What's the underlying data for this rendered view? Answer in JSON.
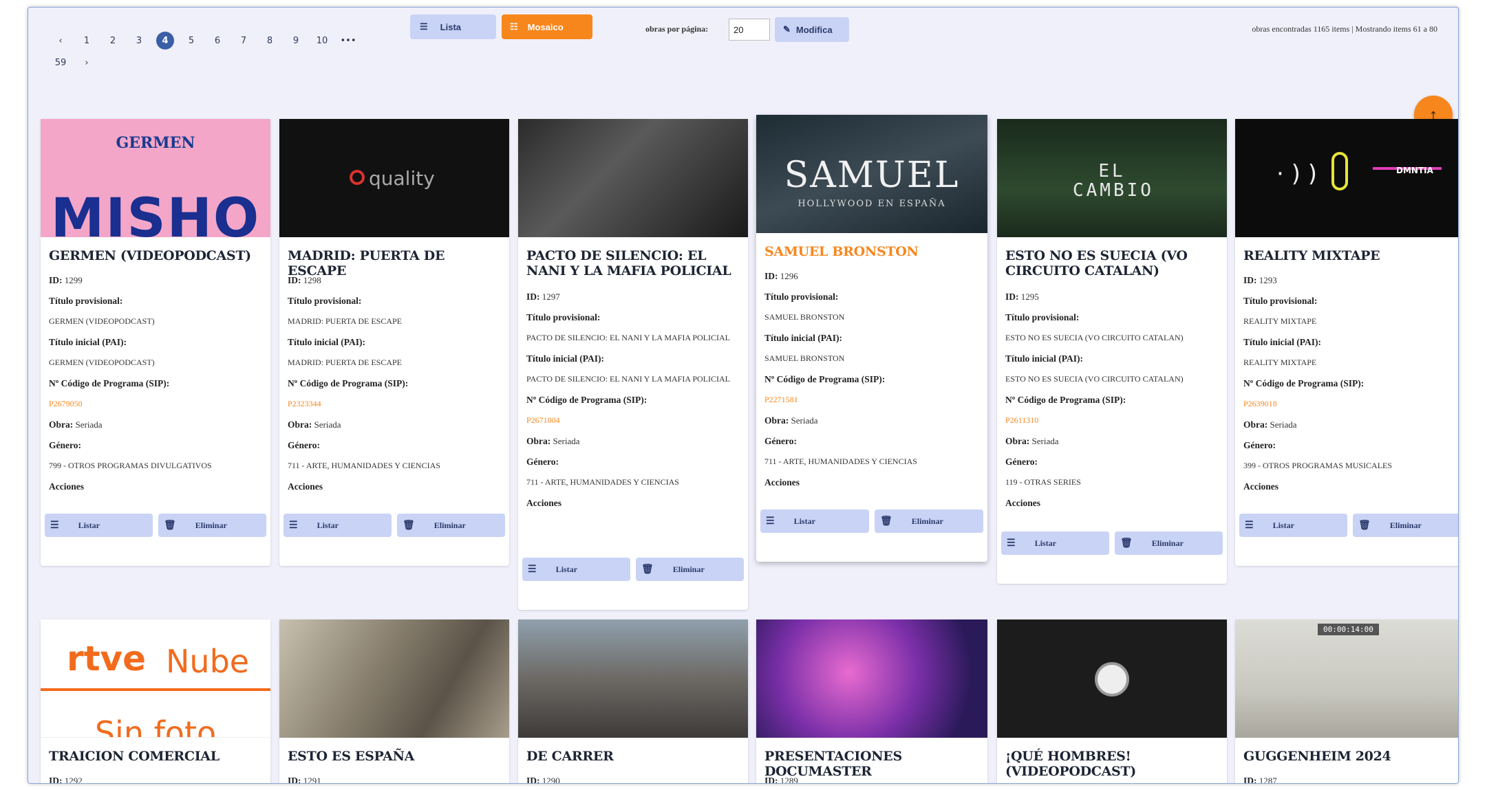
{
  "pager": {
    "prev": "‹",
    "pages": [
      "1",
      "2",
      "3",
      "4",
      "5",
      "6",
      "7",
      "8",
      "9",
      "10"
    ],
    "current": "4",
    "ellipsis": "•••",
    "last": "59",
    "next": "›"
  },
  "view": {
    "lista_label": "Lista",
    "mosaico_label": "Mosaico",
    "per_page_label": "obras por página:",
    "per_page_value": "20",
    "modify_label": "Modifica"
  },
  "summary": "obras encontradas 1165 items | Mostrando items 61 a 80",
  "scroll_top_icon": "arrow-up-icon",
  "labels": {
    "titulo_provisional": "Título provisional:",
    "titulo_inicial": "Título inicial (PAI):",
    "codigo": "Nº Código de Programa (SIP):",
    "obra": "Obra:",
    "genero": "Género:",
    "acciones": "Acciones",
    "listar": "Listar",
    "eliminar": "Eliminar",
    "id": "ID:"
  },
  "cards": [
    {
      "title": "GERMEN (VIDEOPODCAST)",
      "id": "1299",
      "provisional": "GERMEN (VIDEOPODCAST)",
      "inicial": "GERMEN (VIDEOPODCAST)",
      "codigo": "P2679050",
      "obra": "Seriada",
      "genero": "799 - OTROS PROGRAMAS DIVULGATIVOS",
      "thumb_text": "GERMEN",
      "thumb_big": "MISHO"
    },
    {
      "title": "MADRID: PUERTA DE ESCAPE",
      "id": "1298",
      "provisional": "MADRID: PUERTA DE ESCAPE",
      "inicial": "MADRID: PUERTA DE ESCAPE",
      "codigo": "P2323344",
      "obra": "Seriada",
      "genero": "711 - ARTE, HUMANIDADES Y CIENCIAS",
      "thumb_text": "quality"
    },
    {
      "title": "PACTO DE SILENCIO: EL NANI Y LA MAFIA POLICIAL",
      "id": "1297",
      "provisional": "PACTO DE SILENCIO: EL NANI Y LA MAFIA POLICIAL",
      "inicial": "PACTO DE SILENCIO: EL NANI Y LA MAFIA POLICIAL",
      "codigo": "P2671004",
      "obra": "Seriada",
      "genero": "711 - ARTE, HUMANIDADES Y CIENCIAS"
    },
    {
      "title": "SAMUEL BRONSTON",
      "id": "1296",
      "provisional": "SAMUEL BRONSTON",
      "inicial": "SAMUEL BRONSTON",
      "codigo": "P2271581",
      "obra": "Seriada",
      "genero": "711 - ARTE, HUMANIDADES Y CIENCIAS",
      "thumb_text": "SAMUEL",
      "thumb_sub": "HOLLYWOOD EN ESPAÑA"
    },
    {
      "title": "ESTO NO ES SUECIA (VO CIRCUITO CATALAN)",
      "id": "1295",
      "provisional": "ESTO NO ES SUECIA (VO CIRCUITO CATALAN)",
      "inicial": "ESTO NO ES SUECIA (VO CIRCUITO CATALAN)",
      "codigo": "P2611310",
      "obra": "Seriada",
      "genero": "119 - OTRAS SERIES",
      "thumb_text": "EL CAMBIO"
    },
    {
      "title": "REALITY MIXTAPE",
      "id": "1293",
      "provisional": "REALITY MIXTAPE",
      "inicial": "REALITY MIXTAPE",
      "codigo": "P2639018",
      "obra": "Seriada",
      "genero": "399 - OTROS PROGRAMAS MUSICALES",
      "thumb_text": "DMNTIA"
    },
    {
      "title": "TRAICION COMERCIAL",
      "id": "1292",
      "thumb_text": "rtve",
      "thumb_text2": "Nube",
      "thumb_text3": "Sin foto"
    },
    {
      "title": "ESTO ES ESPAÑA",
      "id": "1291"
    },
    {
      "title": "DE CARRER",
      "id": "1290"
    },
    {
      "title": "PRESENTACIONES DOCUMASTER",
      "id": "1289"
    },
    {
      "title": "¡QUÉ HOMBRES! (VIDEOPODCAST)",
      "id": "1288"
    },
    {
      "title": "GUGGENHEIM 2024",
      "id": "1287",
      "thumb_text": "00:00:14:00"
    }
  ],
  "colors": {
    "accent": "#f7861c",
    "button": "#c9d3f5",
    "background": "#f0f0fb",
    "current_page": "#3a5fa6"
  }
}
